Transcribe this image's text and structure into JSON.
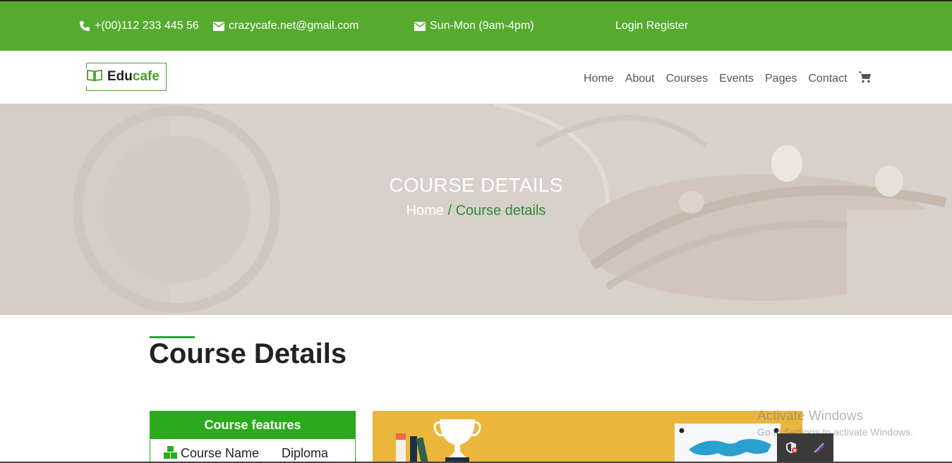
{
  "topbar": {
    "phone": "+(00)112 233 445 56",
    "email": "crazycafe.net@gmail.com",
    "hours": "Sun-Mon (9am-4pm)",
    "auth": "Login Register",
    "background": "#56ab2f"
  },
  "brand": {
    "name_part1": "Edu",
    "name_part2": "cafe",
    "icon": "book-open-icon"
  },
  "nav": {
    "items": [
      "Home",
      "About",
      "Courses",
      "Events",
      "Pages",
      "Contact"
    ],
    "cart_icon": "shopping-cart-icon"
  },
  "hero": {
    "title": "COURSE DETAILS",
    "breadcrumb_home": "Home",
    "breadcrumb_separator": " / ",
    "breadcrumb_current": "Course details"
  },
  "section": {
    "title": "Course Details"
  },
  "features": {
    "heading": "Course features",
    "rows": [
      {
        "label": "Course Name",
        "value": "Diploma",
        "icon": "cubes-icon"
      }
    ]
  },
  "watermark": {
    "line1": "Activate Windows",
    "line2": "Go to Settings to activate Windows."
  },
  "colors": {
    "accent_green": "#56ab2f",
    "feature_green": "#2aaa1c",
    "breadcrumb_green": "#2a8a3a",
    "course_image_bg": "#ebb63c"
  }
}
